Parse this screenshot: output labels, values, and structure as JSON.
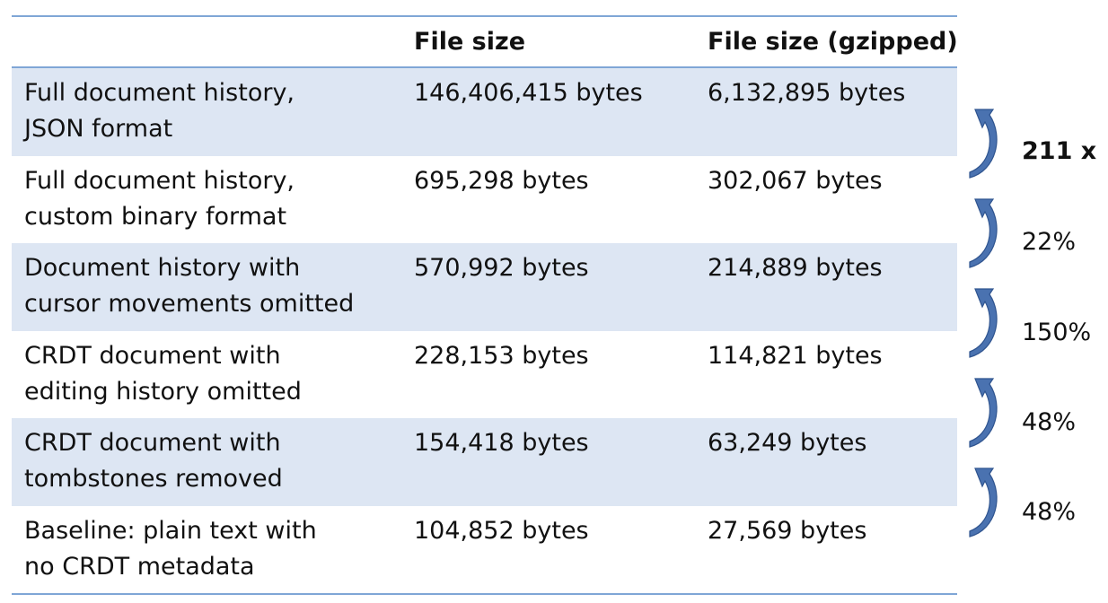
{
  "table": {
    "headers": [
      "",
      "File size",
      "File size (gzipped)"
    ],
    "rows": [
      {
        "label_line1": "Full document history,",
        "label_line2": "JSON format",
        "size": "146,406,415 bytes",
        "gzipped": "6,132,895 bytes",
        "shaded": true
      },
      {
        "label_line1": "Full document history,",
        "label_line2": "custom binary format",
        "size": "695,298 bytes",
        "gzipped": "302,067 bytes",
        "shaded": false
      },
      {
        "label_line1": "Document history with",
        "label_line2": "cursor movements omitted",
        "size": "570,992 bytes",
        "gzipped": "214,889 bytes",
        "shaded": true
      },
      {
        "label_line1": "CRDT document with",
        "label_line2": "editing history omitted",
        "size": "228,153 bytes",
        "gzipped": "114,821 bytes",
        "shaded": false
      },
      {
        "label_line1": "CRDT document with",
        "label_line2": "tombstones removed",
        "size": "154,418 bytes",
        "gzipped": "63,249 bytes",
        "shaded": true
      },
      {
        "label_line1": "Baseline: plain text with",
        "label_line2": "no CRDT metadata",
        "size": "104,852 bytes",
        "gzipped": "27,569 bytes",
        "shaded": false
      }
    ]
  },
  "ratios": [
    {
      "label": "211 x",
      "bold": true
    },
    {
      "label": "22%",
      "bold": false
    },
    {
      "label": "150%",
      "bold": false
    },
    {
      "label": "48%",
      "bold": false
    },
    {
      "label": "48%",
      "bold": false
    }
  ],
  "colors": {
    "rule": "#7fa6d6",
    "shade": "#dde6f3",
    "arrow": "#4a72b0",
    "arrow_edge": "#2f548f"
  },
  "icons": {
    "ratio_arrow": "curved-up-arrow-icon"
  }
}
